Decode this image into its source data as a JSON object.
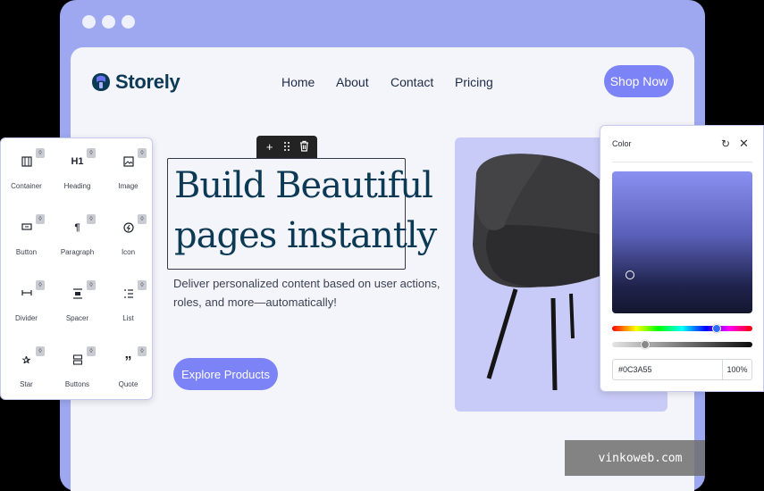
{
  "site": {
    "logo_text": "Storely",
    "nav": [
      "Home",
      "About",
      "Contact",
      "Pricing"
    ],
    "shop_button": "Shop Now"
  },
  "hero": {
    "heading_line1": "Build Beautiful",
    "heading_line2": "pages instantly",
    "subtext_line1": "Deliver personalized content based on user actions,",
    "subtext_line2": "roles, and more—automatically!",
    "cta": "Explore Products"
  },
  "blocks": [
    {
      "label": "Container",
      "icon": "container-icon"
    },
    {
      "label": "Heading",
      "icon": "heading-icon",
      "glyph": "H1"
    },
    {
      "label": "Image",
      "icon": "image-icon"
    },
    {
      "label": "Button",
      "icon": "button-icon"
    },
    {
      "label": "Paragraph",
      "icon": "paragraph-icon",
      "glyph": "¶"
    },
    {
      "label": "Icon",
      "icon": "icon-icon"
    },
    {
      "label": "Divider",
      "icon": "divider-icon"
    },
    {
      "label": "Spacer",
      "icon": "spacer-icon"
    },
    {
      "label": "List",
      "icon": "list-icon"
    },
    {
      "label": "Star",
      "icon": "star-icon"
    },
    {
      "label": "Buttons",
      "icon": "buttons-icon"
    },
    {
      "label": "Quote",
      "icon": "quote-icon",
      "glyph": "”"
    }
  ],
  "color_picker": {
    "title": "Color",
    "hex": "#0C3A55",
    "opacity": "100%"
  },
  "watermark": "vinkoweb.com",
  "colors": {
    "accent": "#7c83f7",
    "brand": "#0c3a55",
    "frame": "#9ea8f0",
    "product_bg": "#c8cbf7"
  }
}
